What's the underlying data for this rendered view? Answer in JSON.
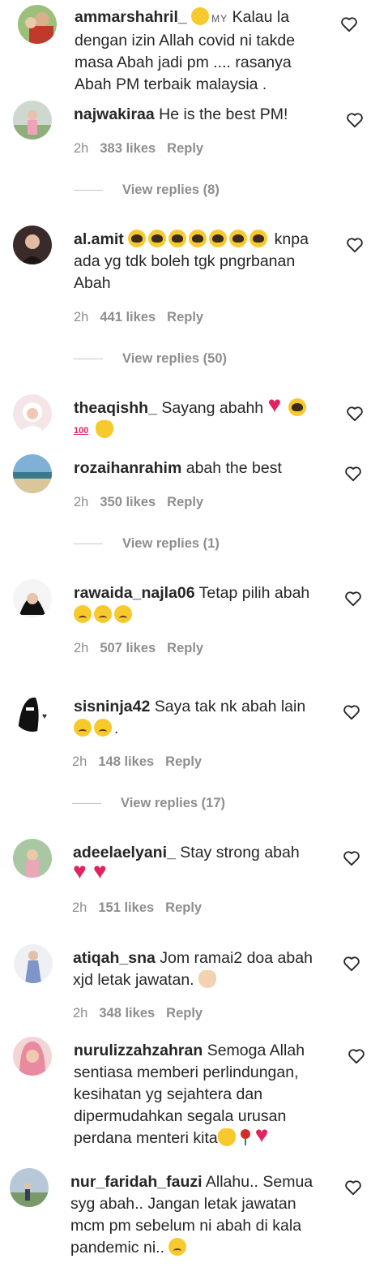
{
  "colors": {
    "text": "#262626",
    "muted": "#8e8e8e",
    "heart_red": "#e0245e"
  },
  "comments": [
    {
      "username": "ammarshahril_",
      "flag": "MY",
      "text": "Kalau la dengan izin Allah covid ni takde masa Abah jadi pm .... rasanya Abah PM terbaik malaysia .",
      "lead_emoji": "worried"
    },
    {
      "username": "najwakiraa",
      "text": "He is the best PM!",
      "time": "2h",
      "likes": "383 likes",
      "reply": "Reply",
      "view_replies": "View replies (8)"
    },
    {
      "username": "al.amit",
      "text": "knpa ada yg tdk boleh tgk pngrbanan Abah",
      "time": "2h",
      "likes": "441 likes",
      "reply": "Reply",
      "view_replies": "View replies (50)"
    },
    {
      "username": "theaqishh_",
      "text": "Sayang abahh"
    },
    {
      "username": "rozaihanrahim",
      "text": "abah the best",
      "time": "2h",
      "likes": "350 likes",
      "reply": "Reply",
      "view_replies": "View replies (1)"
    },
    {
      "username": "rawaida_najla06",
      "text": "Tetap pilih abah",
      "time": "2h",
      "likes": "507 likes",
      "reply": "Reply"
    },
    {
      "username": "sisninja42",
      "text": "Saya tak nk abah lain",
      "tail": ".",
      "time": "2h",
      "likes": "148 likes",
      "reply": "Reply",
      "view_replies": "View replies (17)"
    },
    {
      "username": "adeelaelyani_",
      "text": "Stay strong abah",
      "time": "2h",
      "likes": "151 likes",
      "reply": "Reply"
    },
    {
      "username": "atiqah_sna",
      "text": "Jom ramai2 doa abah xjd letak jawatan.",
      "time": "2h",
      "likes": "348 likes",
      "reply": "Reply"
    },
    {
      "username": "nurulizzahzahran",
      "text": "Semoga Allah sentiasa memberi perlindungan, kesihatan yg sejahtera dan dipermudahkan segala urusan perdana menteri kita"
    },
    {
      "username": "nur_faridah_fauzi",
      "text": "Allahu.. Semua syg abah.. Jangan letak jawatan mcm pm sebelum ni abah di kala pandemic ni.."
    }
  ]
}
